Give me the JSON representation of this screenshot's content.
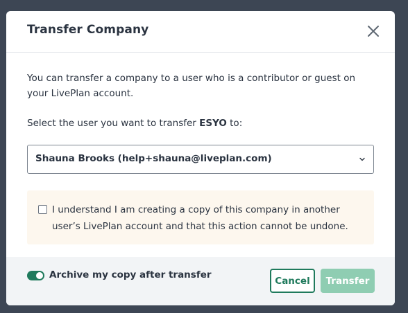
{
  "modal": {
    "title": "Transfer Company",
    "close_icon": "close-icon",
    "description": "You can transfer a company to a user who is a contributor or guest on your LivePlan account.",
    "select_prompt_before": "Select the user you want to transfer ",
    "company_name": "ESYO",
    "select_prompt_after": " to:",
    "user_select": {
      "value": "Shauna Brooks (help+shauna@liveplan.com)",
      "icon": "chevron-down-icon"
    },
    "confirmation": {
      "checked": false,
      "text": "I understand I am creating a copy of this company in another user’s LivePlan account and that this action cannot be undone."
    },
    "footer": {
      "archive_toggle_on": true,
      "archive_label": "Archive my copy after transfer",
      "cancel_label": "Cancel",
      "transfer_label": "Transfer"
    }
  },
  "colors": {
    "accent": "#1f7a5c",
    "accent_disabled": "#8fcdb2",
    "notice_bg": "#fdf7ee",
    "footer_bg": "#f2f4f6",
    "backdrop": "#3d4654"
  }
}
